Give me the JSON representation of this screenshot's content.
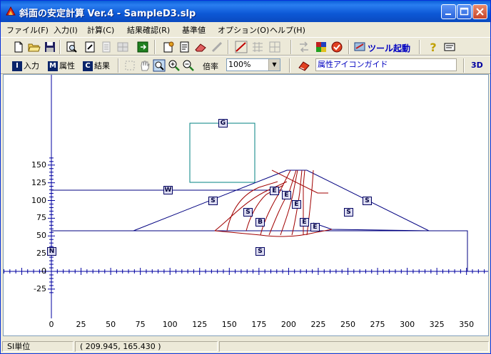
{
  "window": {
    "title": "斜面の安定計算 Ver.4 - SampleD3.slp",
    "controls": [
      "minimize",
      "maximize",
      "close"
    ]
  },
  "menu": [
    "ファイル(F)",
    "入力(I)",
    "計算(C)",
    "結果確認(R)",
    "基準値",
    "オプション(O)",
    "ヘルプ(H)"
  ],
  "toolbar1": {
    "tool_launch_label": "ツール起動"
  },
  "toolbar2": {
    "mode_input": {
      "key": "I",
      "label": "入力"
    },
    "mode_attr": {
      "key": "M",
      "label": "属性"
    },
    "mode_result": {
      "key": "C",
      "label": "結果"
    },
    "zoom_label": "倍率",
    "zoom_value": "100%",
    "attr_guide": "属性アイコンガイド",
    "view_3d": "3D"
  },
  "axes": {
    "x_ticks": [
      "0",
      "25",
      "50",
      "75",
      "100",
      "125",
      "150",
      "175",
      "200",
      "225",
      "250",
      "275",
      "300",
      "325",
      "350"
    ],
    "y_ticks": [
      "150",
      "125",
      "100",
      "75",
      "50",
      "25",
      "0",
      "-25"
    ]
  },
  "drawing_tags": [
    "G",
    "W",
    "S",
    "E",
    "E",
    "E",
    "S",
    "B",
    "E",
    "E",
    "S",
    "S",
    "S",
    "N"
  ],
  "status": {
    "unit": "SI単位",
    "coords": "( 209.945,  165.430 )"
  },
  "colors": {
    "title_blue": "#0a5fd8",
    "ground_line": "#000080",
    "slip_circle": "#a00000",
    "load_box": "#008080"
  }
}
